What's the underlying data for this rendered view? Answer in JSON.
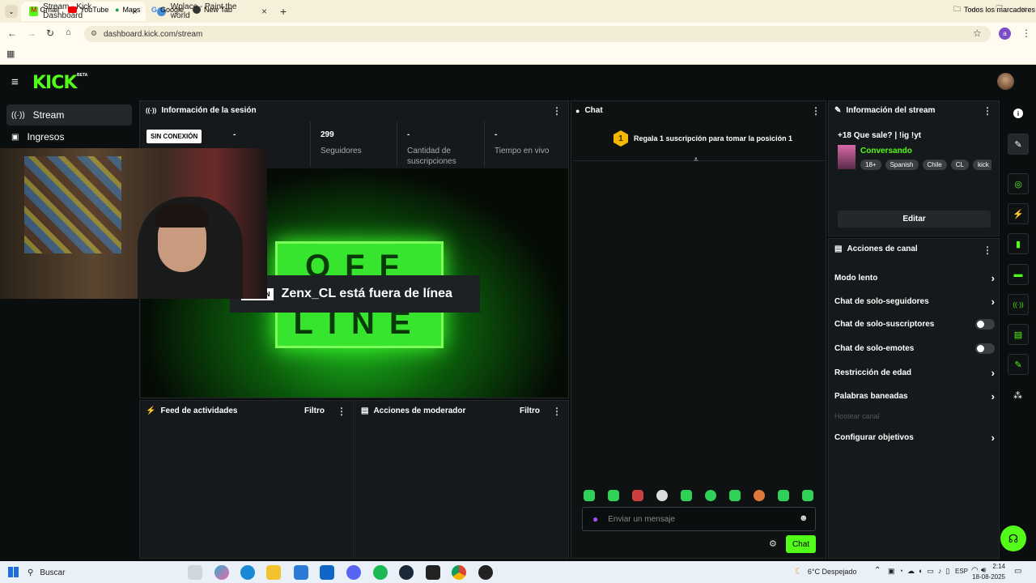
{
  "browser": {
    "tabs": [
      {
        "title": "Stream - Kick Dashboard",
        "active": true
      },
      {
        "title": "Wplace - Paint the world",
        "active": false
      }
    ],
    "url": "dashboard.kick.com/stream",
    "profile_initial": "a",
    "bookmarks": [
      "Gmail",
      "YouTube",
      "Maps",
      "Google",
      "New Tab"
    ],
    "all_bookmarks": "Todos los marcadores"
  },
  "app": {
    "logo": "KICK",
    "logo_badge": "BETA",
    "accent": "#53fc18",
    "sidebar": [
      {
        "label": "Stream",
        "active": true,
        "icon": "broadcast-icon"
      },
      {
        "label": "Ingresos",
        "active": false,
        "icon": "wallet-icon"
      }
    ]
  },
  "session": {
    "title": "Información de la sesión",
    "status": "SIN CONEXIÓN",
    "stats": [
      {
        "value": "-",
        "label": "...dores"
      },
      {
        "value": "299",
        "label": "Seguidores"
      },
      {
        "value": "-",
        "label": "Cantidad de suscripciones"
      },
      {
        "value": "-",
        "label": "Tiempo en vivo"
      }
    ],
    "offline_badge": "...EXIÓN",
    "offline_message": "Zenx_CL está fuera de línea",
    "offline_word_1": "OFF",
    "offline_word_2": "LINE"
  },
  "activity": {
    "title": "Feed de actividades",
    "filter": "Filtro"
  },
  "moderator": {
    "title": "Acciones de moderador",
    "filter": "Filtro"
  },
  "chat": {
    "title": "Chat",
    "gift_rank": "1",
    "gift_text": "Regala 1 suscripción para tomar la posición 1",
    "placeholder": "Enviar un mensaje",
    "send": "Chat"
  },
  "stream_info": {
    "title": "Información del stream",
    "stream_title": "+18 Que sale? | !ig !yt",
    "category": "Conversando",
    "tags": [
      "18+",
      "Spanish",
      "Chile",
      "CL",
      "kick"
    ],
    "edit": "Editar"
  },
  "channel_actions": {
    "title": "Acciones de canal",
    "items": [
      {
        "label": "Modo lento",
        "control": "chevron"
      },
      {
        "label": "Chat de solo-seguidores",
        "control": "chevron"
      },
      {
        "label": "Chat de solo-suscriptores",
        "control": "toggle"
      },
      {
        "label": "Chat de solo-emotes",
        "control": "toggle"
      },
      {
        "label": "Restricción de edad",
        "control": "chevron"
      },
      {
        "label": "Palabras baneadas",
        "control": "chevron"
      },
      {
        "label": "Hostear canal",
        "control": "disabled"
      },
      {
        "label": "Configurar objetivos",
        "control": "chevron"
      }
    ]
  },
  "taskbar": {
    "search": "Buscar",
    "weather": "6°C  Despejado",
    "lang": "ESP",
    "time": "2:14",
    "date": "18-08-2025"
  }
}
